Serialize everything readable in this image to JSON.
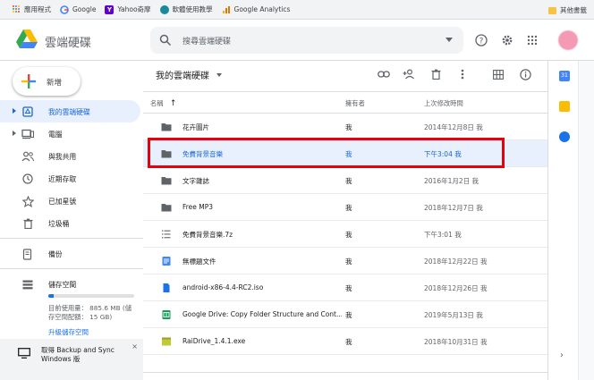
{
  "bookmarks": {
    "items": [
      {
        "label": "應用程式",
        "icon": "apps-grid-icon"
      },
      {
        "label": "Google",
        "icon": "google-g-icon"
      },
      {
        "label": "Yahoo奇摩",
        "icon": "yahoo-icon"
      },
      {
        "label": "軟體使用教學",
        "icon": "tutorial-site-icon"
      },
      {
        "label": "Google Analytics",
        "icon": "analytics-icon"
      }
    ],
    "other": "其他書籤"
  },
  "header": {
    "brand": "雲端硬碟",
    "search_placeholder": "搜尋雲端硬碟"
  },
  "sidebar": {
    "new_label": "新增",
    "items": [
      {
        "label": "我的雲端硬碟",
        "icon": "my-drive-icon",
        "active": true,
        "expand": true
      },
      {
        "label": "電腦",
        "icon": "computer-icon",
        "active": false,
        "expand": true
      },
      {
        "label": "與我共用",
        "icon": "shared-icon",
        "active": false,
        "expand": false
      },
      {
        "label": "近期存取",
        "icon": "clock-icon",
        "active": false,
        "expand": false
      },
      {
        "label": "已加星號",
        "icon": "star-icon",
        "active": false,
        "expand": false
      },
      {
        "label": "垃圾桶",
        "icon": "trash-icon",
        "active": false,
        "expand": false
      }
    ],
    "backup_label": "備份",
    "storage_label": "儲存空間",
    "storage_line1": "目前使用量： 885.6 MB (儲",
    "storage_line2": "存空間配額： 15 GB)",
    "storage_fraction": 0.059,
    "upgrade": "升級儲存空間",
    "backup_promo_line1": "取得 Backup and Sync",
    "backup_promo_line2": "Windows 版",
    "close": "×"
  },
  "main": {
    "breadcrumb": "我的雲端硬碟",
    "columns": {
      "name": "名稱",
      "sort_arrow": "↑",
      "owner": "擁有者",
      "modified": "上次修改時間"
    },
    "rows": [
      {
        "name": "花卉圖片",
        "type": "folder",
        "owner": "我",
        "modified": "2014年12月8日 我"
      },
      {
        "name": "免費背景音樂",
        "type": "folder",
        "owner": "我",
        "modified": "下午3:04 我",
        "selected": true
      },
      {
        "name": "文字雜誌",
        "type": "folder",
        "owner": "我",
        "modified": "2016年1月2日 我"
      },
      {
        "name": "Free MP3",
        "type": "folder",
        "owner": "我",
        "modified": "2018年12月7日 我"
      },
      {
        "name": "免費背景音樂.7z",
        "type": "archive",
        "owner": "我",
        "modified": "下午3:01 我"
      },
      {
        "name": "無標題文件",
        "type": "doc",
        "owner": "我",
        "modified": "2018年12月22日 我"
      },
      {
        "name": "android-x86-4.4-RC2.iso",
        "type": "file",
        "owner": "我",
        "modified": "2018年12月26日 我"
      },
      {
        "name": "Google Drive: Copy Folder Structure and Cont...",
        "type": "sheet",
        "owner": "我",
        "modified": "2019年5月13日 我"
      },
      {
        "name": "RaiDrive_1.4.1.exe",
        "type": "exe",
        "owner": "我",
        "modified": "2018年10月31日 我"
      }
    ]
  },
  "right_panel": {
    "calendar_label": "31",
    "chevron": "›"
  },
  "colors": {
    "accent": "#1a73e8",
    "selected_bg": "#e8f0fe",
    "highlight": "#e8000b"
  }
}
